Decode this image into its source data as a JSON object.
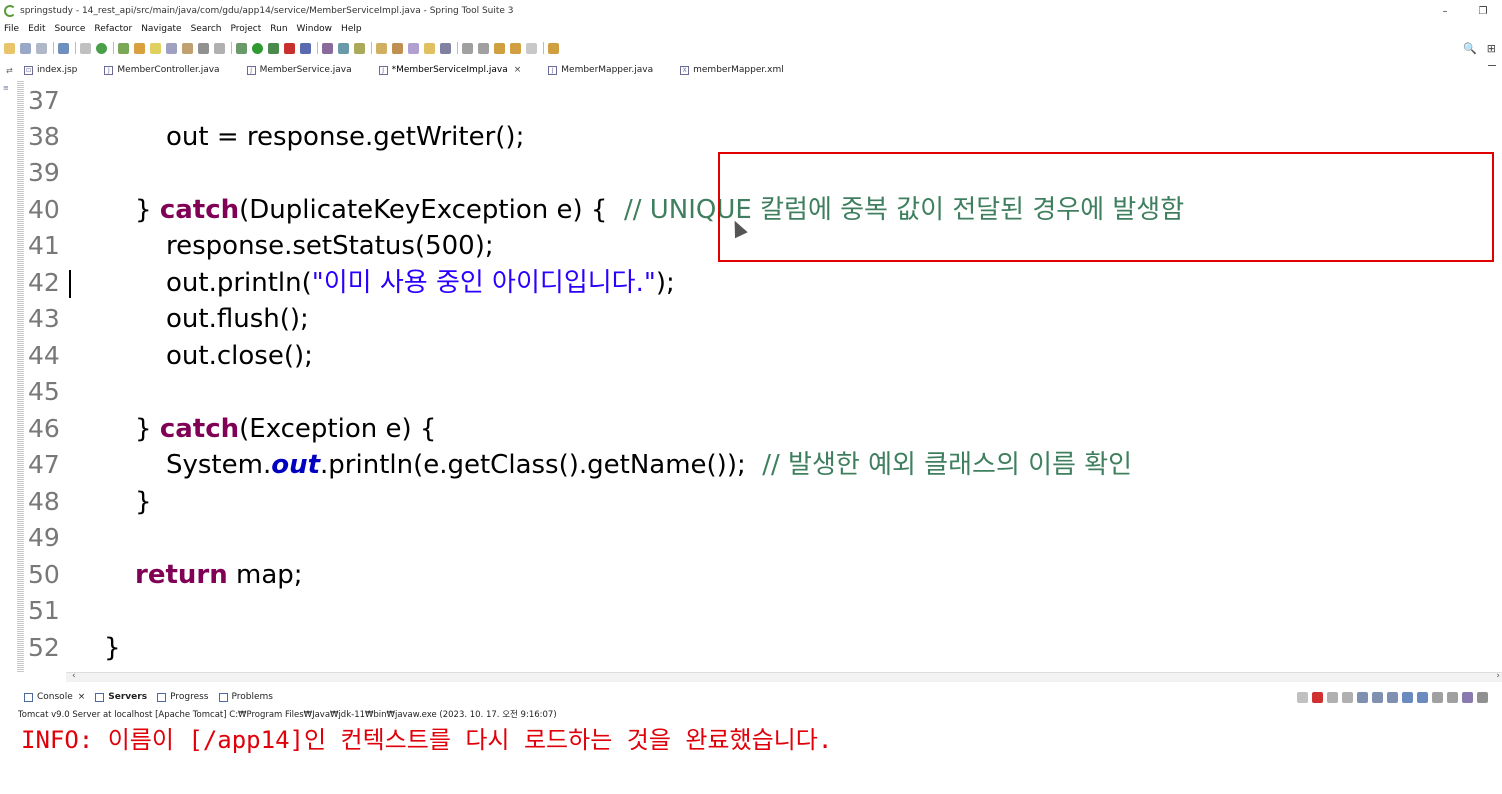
{
  "window": {
    "title": "springstudy - 14_rest_api/src/main/java/com/gdu/app14/service/MemberServiceImpl.java - Spring Tool Suite 3",
    "minimize": "–",
    "restore": "❐"
  },
  "menu": [
    "File",
    "Edit",
    "Source",
    "Refactor",
    "Navigate",
    "Search",
    "Project",
    "Run",
    "Window",
    "Help"
  ],
  "toolbar": {
    "search_icon": "🔍",
    "perspective_icon": "⊞"
  },
  "tabs": [
    {
      "label": "index.jsp",
      "icon": "⊡"
    },
    {
      "label": "MemberController.java",
      "icon": "J"
    },
    {
      "label": "MemberService.java",
      "icon": "J"
    },
    {
      "label": "*MemberServiceImpl.java",
      "icon": "J",
      "active": true,
      "close": "×"
    },
    {
      "label": "MemberMapper.java",
      "icon": "J"
    },
    {
      "label": "memberMapper.xml",
      "icon": "X"
    }
  ],
  "editor": {
    "lines": [
      {
        "num": "37"
      },
      {
        "num": "38",
        "a": "out = response.getWriter();"
      },
      {
        "num": "39"
      },
      {
        "num": "40",
        "kw": "catch",
        "b": "} ",
        "c": "(DuplicateKeyException e) {  ",
        "cmt": "// UNIQUE 칼럼에 중복 값이 전달된 경우에 발생함"
      },
      {
        "num": "41",
        "a": "response.setStatus(500);"
      },
      {
        "num": "42",
        "a": "out.println(",
        "str": "\"이미 사용 중인 아이디입니다.\"",
        "d": ");"
      },
      {
        "num": "43",
        "a": "out.flush();"
      },
      {
        "num": "44",
        "a": "out.close();"
      },
      {
        "num": "45"
      },
      {
        "num": "46",
        "b": "} ",
        "kw": "catch",
        "c": "(Exception e) {"
      },
      {
        "num": "47",
        "a": "System.",
        "st": "out",
        "d": ".println(e.getClass().getName());  ",
        "cmt": "// 발생한 예외 클래스의 이름 확인"
      },
      {
        "num": "48",
        "a": "}"
      },
      {
        "num": "49"
      },
      {
        "num": "50",
        "kw": "return",
        "c": " map;"
      },
      {
        "num": "51"
      },
      {
        "num": "52",
        "a": "}"
      }
    ]
  },
  "console": {
    "tabs": [
      {
        "label": "Console",
        "close": "×"
      },
      {
        "label": "Servers",
        "bold": true
      },
      {
        "label": "Progress"
      },
      {
        "label": "Problems"
      }
    ],
    "path": "Tomcat v9.0 Server at localhost [Apache Tomcat] C:₩Program Files₩Java₩jdk-11₩bin₩javaw.exe  (2023. 10. 17. 오전 9:16:07)",
    "output": "INFO: 이름이 [/app14]인 컨텍스트를 다시 로드하는 것을 완료했습니다."
  },
  "colors": {
    "keyword": "#7f0055",
    "string": "#2a00ff",
    "comment": "#3f7f5f",
    "console_error": "#e0000a",
    "annotation_box": "#e00000"
  }
}
